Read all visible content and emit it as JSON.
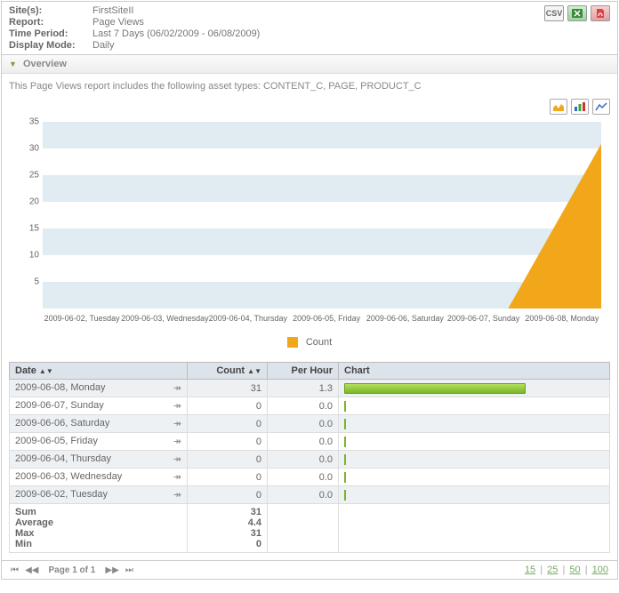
{
  "meta": {
    "sites_label": "Site(s):",
    "sites_value": "FirstSiteII",
    "report_label": "Report:",
    "report_value": "Page Views",
    "period_label": "Time Period:",
    "period_value": "Last 7 Days (06/02/2009 - 06/08/2009)",
    "mode_label": "Display Mode:",
    "mode_value": "Daily"
  },
  "export": {
    "csv": "CSV",
    "xls": "X",
    "pdf": "A"
  },
  "section_title": "Overview",
  "intro": "This Page Views report includes the following asset types: CONTENT_C, PAGE, PRODUCT_C",
  "legend_label": "Count",
  "colors": {
    "series": "#f2a71b",
    "band": "#e1ebf2",
    "bar": "#8cc63f"
  },
  "chart_data": {
    "type": "area",
    "title": "",
    "xlabel": "",
    "ylabel": "",
    "ylim": [
      0,
      35
    ],
    "yticks": [
      5,
      10,
      15,
      20,
      25,
      30,
      35
    ],
    "categories": [
      "2009-06-02, Tuesday",
      "2009-06-03, Wednesday",
      "2009-06-04, Thursday",
      "2009-06-05, Friday",
      "2009-06-06, Saturday",
      "2009-06-07, Sunday",
      "2009-06-08, Monday"
    ],
    "series": [
      {
        "name": "Count",
        "values": [
          0,
          0,
          0,
          0,
          0,
          0,
          31
        ]
      }
    ]
  },
  "table": {
    "headers": {
      "date": "Date",
      "count": "Count",
      "per_hour": "Per Hour",
      "chart": "Chart"
    },
    "rows": [
      {
        "date": "2009-06-08, Monday",
        "count": 31,
        "per_hour": "1.3"
      },
      {
        "date": "2009-06-07, Sunday",
        "count": 0,
        "per_hour": "0.0"
      },
      {
        "date": "2009-06-06, Saturday",
        "count": 0,
        "per_hour": "0.0"
      },
      {
        "date": "2009-06-05, Friday",
        "count": 0,
        "per_hour": "0.0"
      },
      {
        "date": "2009-06-04, Thursday",
        "count": 0,
        "per_hour": "0.0"
      },
      {
        "date": "2009-06-03, Wednesday",
        "count": 0,
        "per_hour": "0.0"
      },
      {
        "date": "2009-06-02, Tuesday",
        "count": 0,
        "per_hour": "0.0"
      }
    ],
    "summary": {
      "sum_label": "Sum",
      "sum_value": 31,
      "avg_label": "Average",
      "avg_value": "4.4",
      "max_label": "Max",
      "max_value": 31,
      "min_label": "Min",
      "min_value": 0
    }
  },
  "pager": {
    "label": "Page 1 of 1",
    "sizes": [
      "15",
      "25",
      "50",
      "100"
    ]
  }
}
